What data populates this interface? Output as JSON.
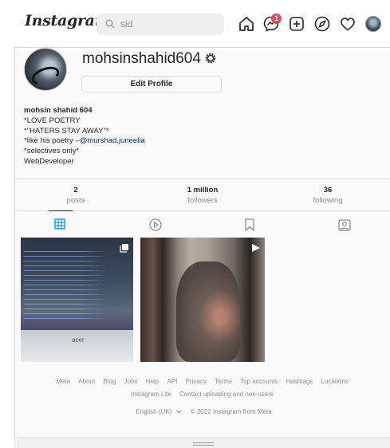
{
  "nav": {
    "logo": "Instagram",
    "search_value": "sid",
    "notification_count": "1"
  },
  "profile": {
    "username": "mohsinshahid604",
    "edit_button": "Edit Profile",
    "bio": {
      "name": "mohsin shahid 604",
      "lines": [
        "*LOVE POETRY",
        "*\"HATERS STAY AWAY\"*",
        "*selectives only*",
        "WebDeveloper"
      ],
      "like_prefix": "*like his poetry –",
      "mention": "@murshad.juneelia"
    }
  },
  "stats": [
    {
      "value": "2",
      "label": "posts"
    },
    {
      "value": "1 million",
      "label": "followers"
    },
    {
      "value": "36",
      "label": "following"
    }
  ],
  "tabs": [
    "grid-icon",
    "reels-icon",
    "saved-icon",
    "tagged-icon"
  ],
  "posts": [
    {
      "brand": "acer",
      "type": "carousel"
    },
    {
      "type": "video"
    }
  ],
  "footer": {
    "links": [
      "Meta",
      "About",
      "Blog",
      "Jobs",
      "Help",
      "API",
      "Privacy",
      "Terms",
      "Top accounts",
      "Hashtags",
      "Locations"
    ],
    "links2": [
      "Instagram Lite",
      "Contact uploading and non-users"
    ],
    "language": "English (UK)",
    "copyright": "© 2022 Instagram from Meta"
  },
  "colors": {
    "active_tab": "#0095f6",
    "badge": "#ed4956",
    "mention": "#00376b"
  }
}
